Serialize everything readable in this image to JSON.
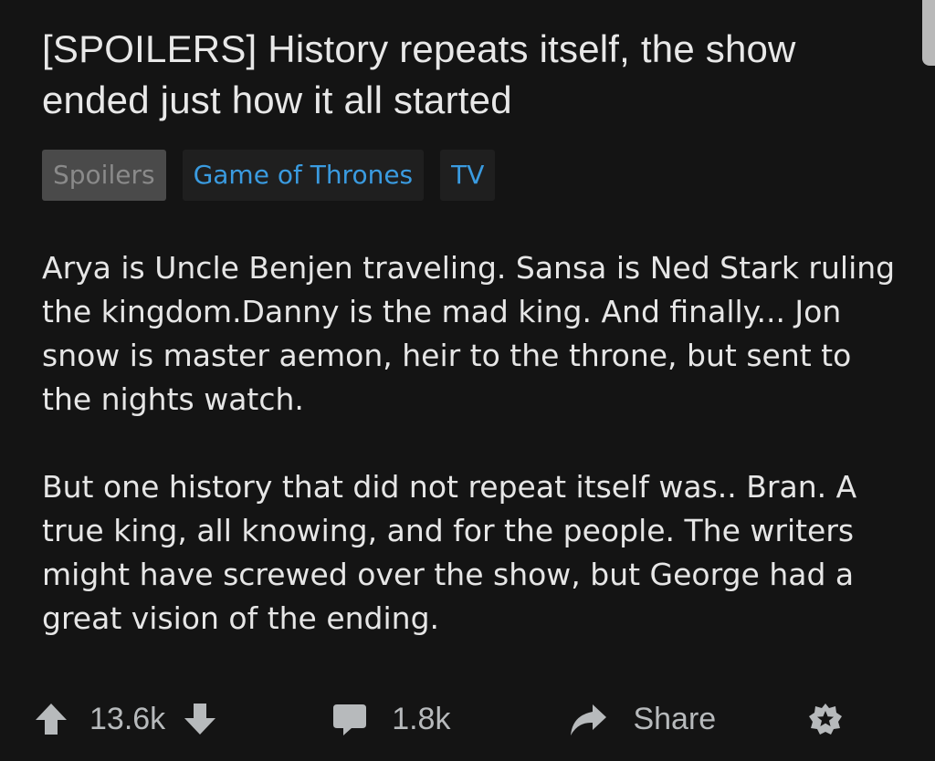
{
  "post": {
    "title": "[SPOILERS] History repeats itself, the show ended just how it all started",
    "flairs": [
      {
        "label": "Spoilers",
        "color": "#8a8a8a",
        "bg": "#4a4a4a"
      },
      {
        "label": "Game of Thrones",
        "color": "#3a9be0",
        "bg": "#1f1f1f"
      },
      {
        "label": "TV",
        "color": "#3a9be0",
        "bg": "#1f1f1f"
      }
    ],
    "paragraphs": [
      "Arya is Uncle Benjen traveling. Sansa is Ned Stark ruling the kingdom.Danny is the mad king. And finally... Jon snow is master aemon, heir to the throne, but sent to the nights watch.",
      "But one history that did not repeat itself was.. Bran. A true king, all knowing, and for the people. The writers might have screwed over the show, but George had a great vision of the ending."
    ]
  },
  "actions": {
    "upvote_icon": "arrow-up-icon",
    "score": "13.6k",
    "downvote_icon": "arrow-down-icon",
    "comment_icon": "comment-bubble-icon",
    "comment_count": "1.8k",
    "share_icon": "share-arrow-icon",
    "share_label": "Share",
    "award_icon": "award-star-icon"
  },
  "colors": {
    "background": "#141414",
    "text": "#e6e6e6",
    "flair_link": "#3a9be0",
    "action_text": "#b7babc"
  }
}
